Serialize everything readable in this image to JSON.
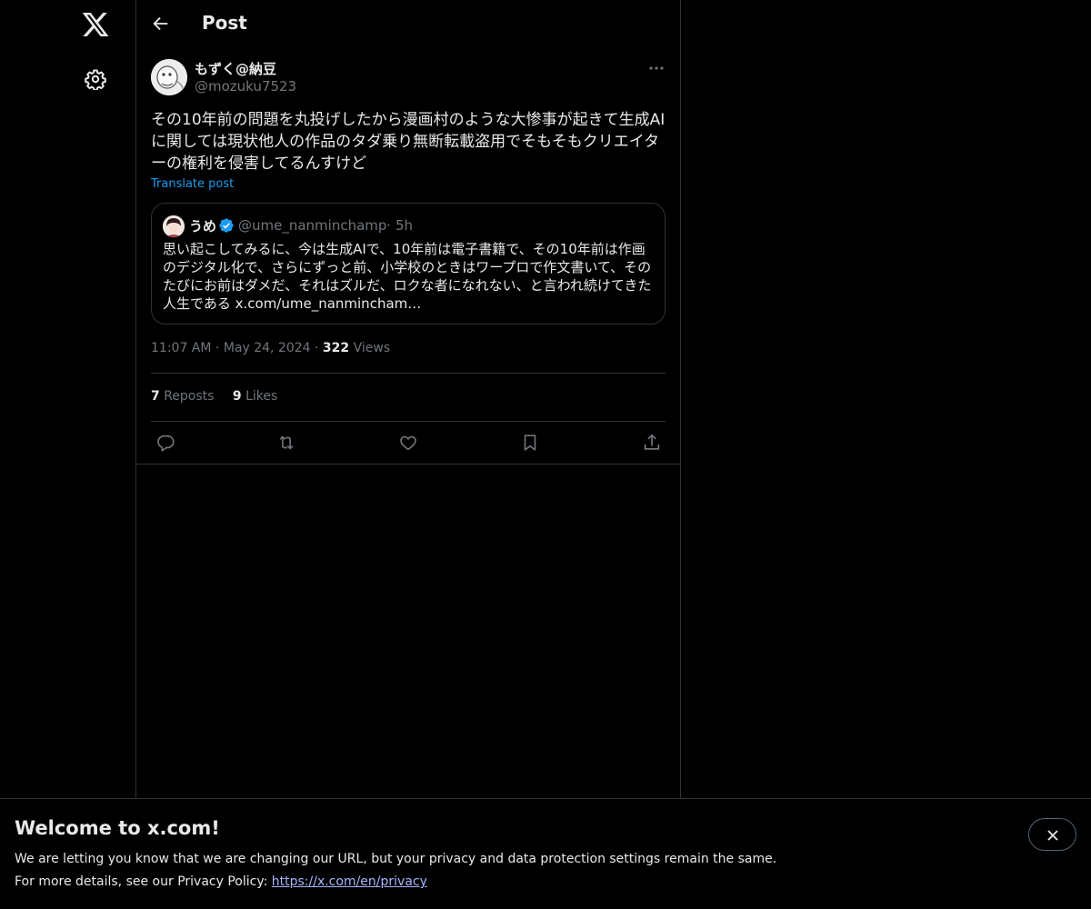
{
  "nav": {
    "logo": "x-logo-icon",
    "settings": "gear-icon"
  },
  "header": {
    "title": "Post",
    "back_icon": "arrow-left-icon"
  },
  "post": {
    "author_name": "もずく@納豆",
    "author_handle": "@mozuku7523",
    "text": "その10年前の問題を丸投げしたから漫画村のような大惨事が起きて生成AIに関しては現状他人の作品のタダ乗り無断転載盗用でそもそもクリエイターの権利を侵害してるんすけど",
    "translate_label": "Translate post",
    "time": "11:07 AM",
    "date": "May 24, 2024",
    "views_count": "322",
    "views_label": "Views",
    "reposts_count": "7",
    "reposts_label": "Reposts",
    "likes_count": "9",
    "likes_label": "Likes"
  },
  "quote": {
    "name": "うめ",
    "handle": "@ume_nanminchamp",
    "time": "5h",
    "text": "思い起こしてみるに、今は生成AIで、10年前は電子書籍で、その10年前は作画のデジタル化で、さらにずっと前、小学校のときはワープロで作文書いて、そのたびにお前はダメだ、それはズルだ、ロクな者になれない、と言われ続けてきた人生である x.com/ume_nanmincham…"
  },
  "actions": [
    "reply-icon",
    "repost-icon",
    "like-icon",
    "bookmark-icon",
    "share-icon"
  ],
  "banner": {
    "title": "Welcome to x.com!",
    "line1": "We are letting you know that we are changing our URL, but your privacy and data protection settings remain the same.",
    "line2_prefix": "For more details, see our Privacy Policy: ",
    "link": "https://x.com/en/privacy"
  },
  "colors": {
    "background": "#000000",
    "text": "#e7e9ea",
    "muted": "#71767b",
    "accent": "#1d9bf0",
    "border": "#2f3336",
    "link": "#a8b5ff"
  }
}
